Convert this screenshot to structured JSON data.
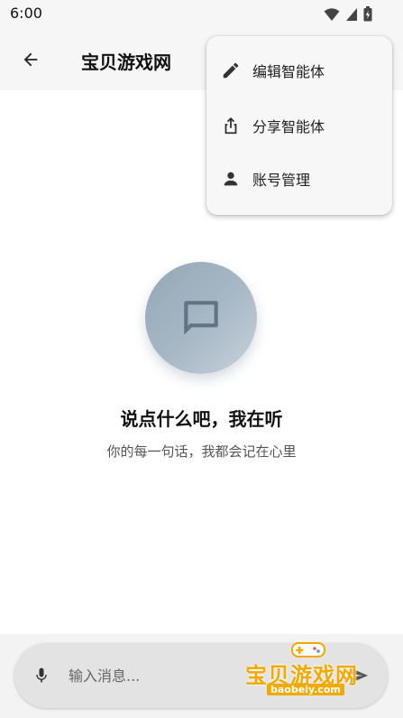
{
  "status_bar": {
    "time": "6:00"
  },
  "app_bar": {
    "title": "宝贝游戏网",
    "back_icon": "arrow-left-icon"
  },
  "menu": {
    "items": [
      {
        "label": "编辑智能体",
        "icon": "pencil-icon"
      },
      {
        "label": "分享智能体",
        "icon": "share-icon"
      },
      {
        "label": "账号管理",
        "icon": "person-icon"
      }
    ]
  },
  "empty_state": {
    "icon": "chat-bubble-icon",
    "title": "说点什么吧，我在听",
    "subtitle": "你的每一句话，我都会记在心里"
  },
  "composer": {
    "placeholder": "输入消息...",
    "mic_icon": "microphone-icon",
    "send_icon": "send-icon"
  },
  "watermark": {
    "text": "宝贝游戏网",
    "url": "baobeiy.com"
  },
  "colors": {
    "accent_gray": "#94a7b6",
    "watermark_orange": "#f2a900"
  }
}
